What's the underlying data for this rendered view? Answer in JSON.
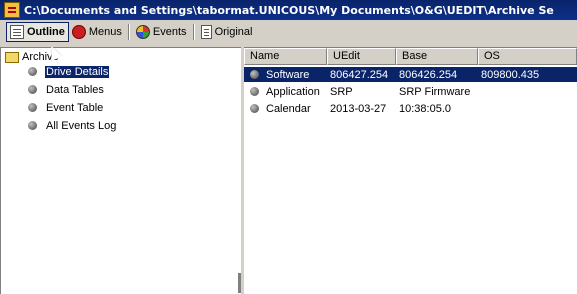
{
  "window": {
    "title": "C:\\Documents and Settings\\tabormat.UNICOUS\\My Documents\\O&G\\UEDIT\\Archive Se"
  },
  "toolbar": {
    "outline_label": "Outline",
    "menus_label": "Menus",
    "events_label": "Events",
    "original_label": "Original"
  },
  "tree": {
    "root_label": "Archive",
    "items": [
      {
        "label": "Drive Details",
        "selected": true
      },
      {
        "label": "Data Tables",
        "selected": false
      },
      {
        "label": "Event Table",
        "selected": false
      },
      {
        "label": "All Events Log",
        "selected": false
      }
    ]
  },
  "list": {
    "columns": [
      "Name",
      "UEdit",
      "Base",
      "OS"
    ],
    "rows": [
      {
        "name": "Software",
        "uedit": "806427.254",
        "base": "806426.254",
        "os": "809800.435",
        "selected": true
      },
      {
        "name": "Application",
        "uedit": "SRP",
        "base": "SRP Firmware",
        "os": "",
        "selected": false
      },
      {
        "name": "Calendar",
        "uedit": "2013-03-27",
        "base": "10:38:05.0",
        "os": "",
        "selected": false
      }
    ]
  },
  "colors": {
    "title_bar": "#0a246a",
    "selection": "#0a246a",
    "chrome": "#d4d0c8"
  }
}
